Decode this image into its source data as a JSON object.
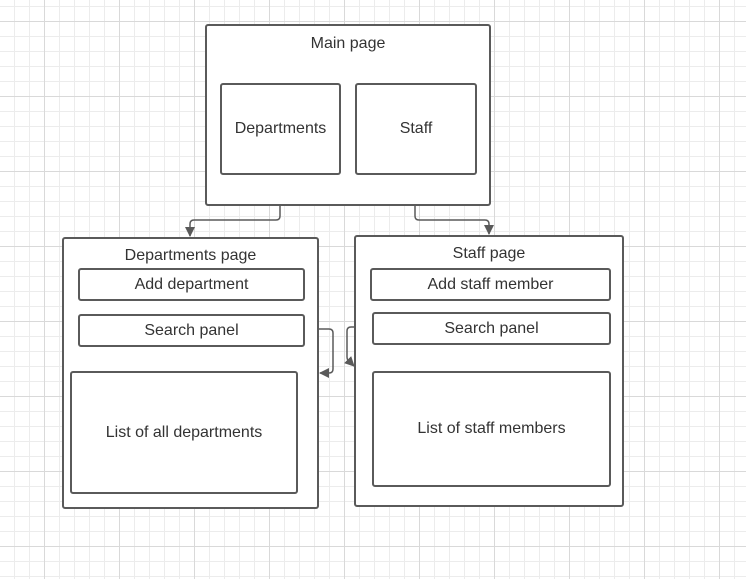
{
  "main_page": {
    "title": "Main page",
    "buttons": {
      "departments": "Departments",
      "staff": "Staff"
    }
  },
  "departments_page": {
    "title": "Departments page",
    "add_button": "Add department",
    "search_panel": "Search panel",
    "list": "List of all departments"
  },
  "staff_page": {
    "title": "Staff page",
    "add_button": "Add staff member",
    "search_panel": "Search panel",
    "list": "List of staff members"
  },
  "colors": {
    "stroke": "#5a5a5a",
    "text": "#333333",
    "grid_major": "#d9d9d9",
    "grid_minor": "#ececec",
    "background": "#ffffff"
  }
}
